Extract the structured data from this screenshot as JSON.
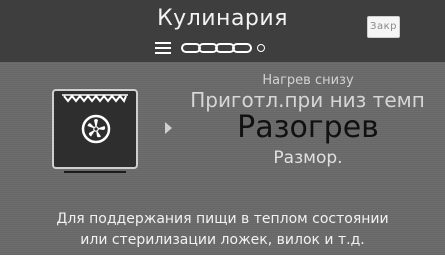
{
  "header": {
    "title": "Кулинария",
    "close_label": "Закр"
  },
  "progress": {
    "segments": 4
  },
  "mode": {
    "heading": "Нагрев снизу",
    "option_above": "Приготл.при низ темп",
    "selected": "Разогрев",
    "option_below": "Размор."
  },
  "description": {
    "line1": "Для поддержания пищи в теплом состоянии",
    "line2": "или стерилизации ложек, вилок и т.д."
  },
  "colors": {
    "header_bg": "#3e3e3e",
    "screen_bg": "#6b6b6b",
    "selected_text": "#111111",
    "icon_bg": "#2e2e2e"
  }
}
